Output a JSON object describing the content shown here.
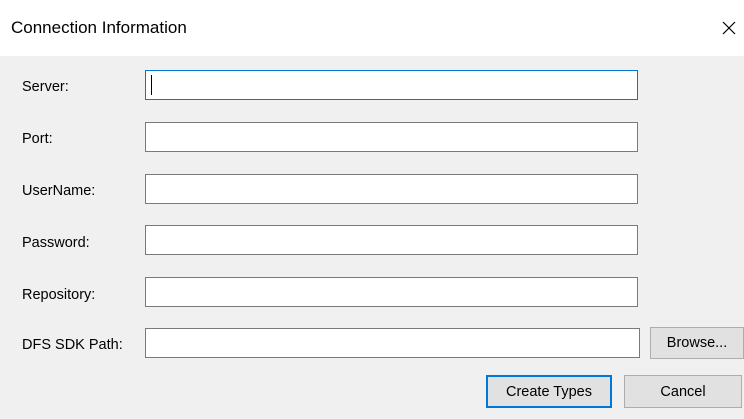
{
  "window": {
    "title": "Connection Information",
    "close_icon": "close-icon"
  },
  "form": {
    "server": {
      "label": "Server:",
      "value": ""
    },
    "port": {
      "label": "Port:",
      "value": ""
    },
    "username": {
      "label": "UserName:",
      "value": ""
    },
    "password": {
      "label": "Password:",
      "value": ""
    },
    "repository": {
      "label": "Repository:",
      "value": ""
    },
    "dfs_sdk_path": {
      "label": "DFS SDK Path:",
      "value": ""
    }
  },
  "buttons": {
    "browse": "Browse...",
    "create_types": "Create Types",
    "cancel": "Cancel"
  },
  "colors": {
    "focus_border": "#0078d7",
    "dialog_background": "#f0f0f0",
    "titlebar_background": "#ffffff"
  }
}
